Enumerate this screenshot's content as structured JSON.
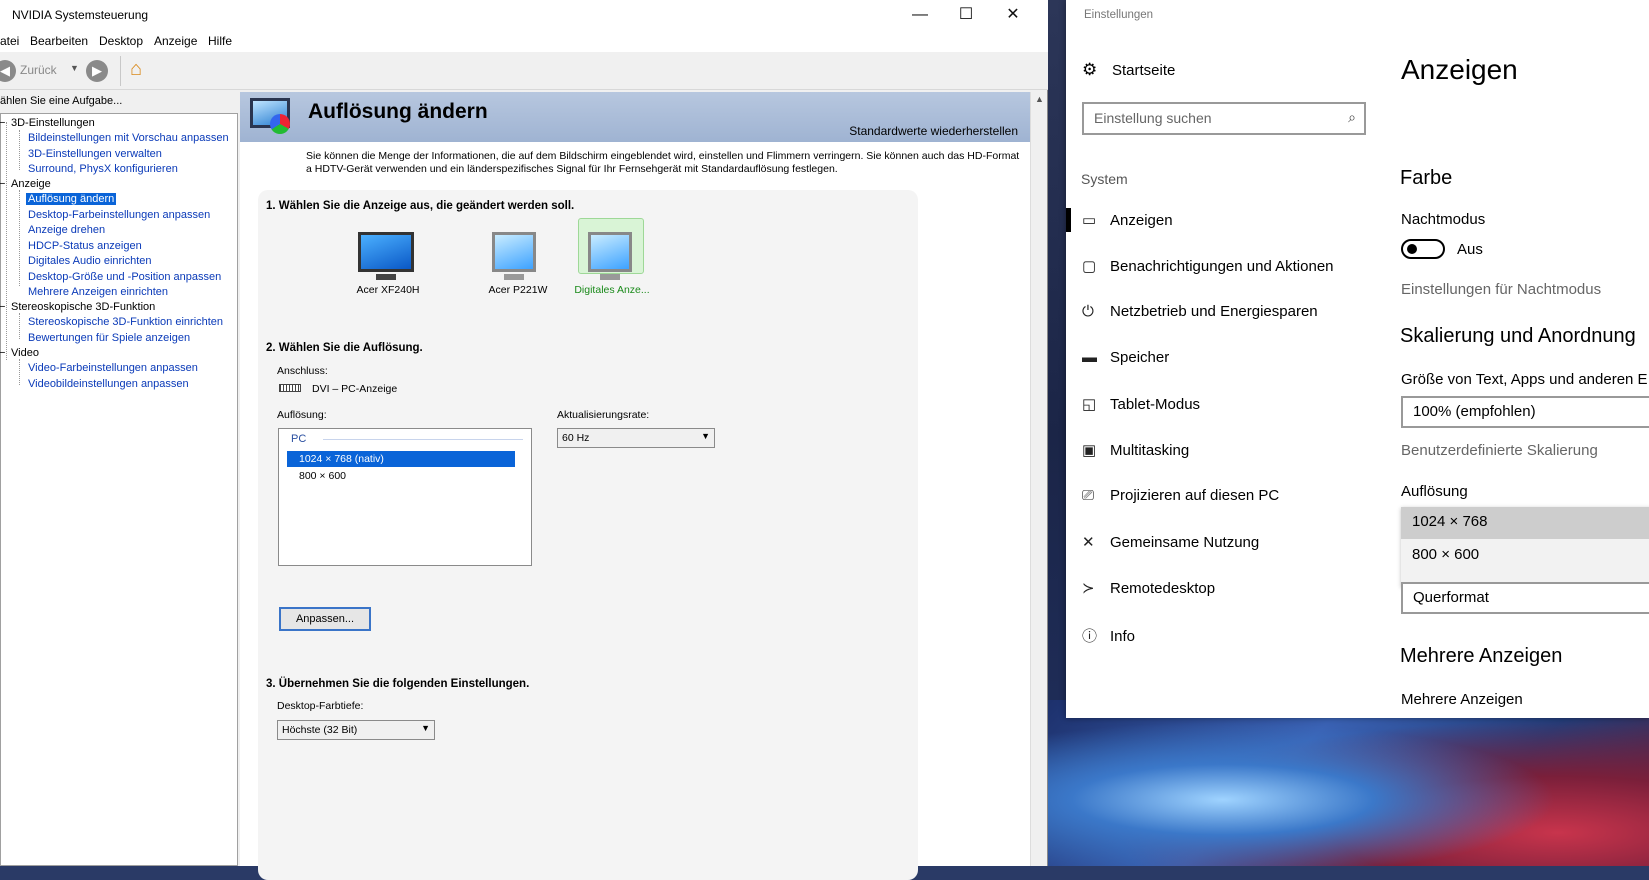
{
  "nv": {
    "title": "NVIDIA Systemsteuerung",
    "caption": {
      "min": "—",
      "max": "☐",
      "close": "✕"
    },
    "menu": [
      "atei",
      "Bearbeiten",
      "Desktop",
      "Anzeige",
      "Hilfe"
    ],
    "back_label": "Zurück",
    "task_label": "ählen Sie eine Aufgabe...",
    "tree": {
      "g3d": "3D-Einstellungen",
      "g3d_items": [
        "Bildeinstellungen mit Vorschau anpassen",
        "3D-Einstellungen verwalten",
        "Surround, PhysX konfigurieren"
      ],
      "gdisp": "Anzeige",
      "gdisp_items": [
        "Auflösung ändern",
        "Desktop-Farbeinstellungen anpassen",
        "Anzeige drehen",
        "HDCP-Status anzeigen",
        "Digitales Audio einrichten",
        "Desktop-Größe und -Position anpassen",
        "Mehrere Anzeigen einrichten"
      ],
      "gstereo": "Stereoskopische 3D-Funktion",
      "gstereo_items": [
        "Stereoskopische 3D-Funktion einrichten",
        "Bewertungen für Spiele anzeigen"
      ],
      "gvideo": "Video",
      "gvideo_items": [
        "Video-Farbeinstellungen anpassen",
        "Videobildeinstellungen anpassen"
      ]
    },
    "page_title": "Auflösung ändern",
    "restore": "Standardwerte wiederherstellen",
    "description": "Sie können die Menge der Informationen, die auf dem Bildschirm eingeblendet wird, einstellen und Flimmern verringern. Sie können auch das HD-Format a HDTV-Gerät verwenden und ein länderspezifisches Signal für Ihr Fernsehgerät mit Standardauflösung festlegen.",
    "step1": "1. Wählen Sie die Anzeige aus, die geändert werden soll.",
    "displays": [
      "Acer XF240H",
      "Acer P221W",
      "Digitales Anze..."
    ],
    "step2": "2. Wählen Sie die Auflösung.",
    "connection_label": "Anschluss:",
    "connection_value": "DVI – PC-Anzeige",
    "resolution_label": "Auflösung:",
    "resolution_group": "PC",
    "resolutions": [
      "1024 × 768 (nativ)",
      "800 × 600"
    ],
    "refresh_label": "Aktualisierungsrate:",
    "refresh_value": "60 Hz",
    "customize_button": "Anpassen...",
    "step3": "3. Übernehmen Sie die folgenden Einstellungen.",
    "depth_label": "Desktop-Farbtiefe:",
    "depth_value": "Höchste (32 Bit)"
  },
  "settings": {
    "window_title": "Einstellungen",
    "home": "Startseite",
    "search_placeholder": "Einstellung suchen",
    "section": "System",
    "nav": [
      "Anzeigen",
      "Benachrichtigungen und Aktionen",
      "Netzbetrieb und Energiesparen",
      "Speicher",
      "Tablet-Modus",
      "Multitasking",
      "Projizieren auf diesen PC",
      "Gemeinsame Nutzung",
      "Remotedesktop",
      "Info"
    ],
    "page_title": "Anzeigen",
    "color_heading": "Farbe",
    "night_mode_label": "Nachtmodus",
    "night_mode_state": "Aus",
    "night_mode_link": "Einstellungen für Nachtmodus",
    "scale_heading": "Skalierung und Anordnung",
    "scale_label": "Größe von Text, Apps und anderen E",
    "scale_value": "100% (empfohlen)",
    "custom_scale_link": "Benutzerdefinierte Skalierung",
    "resolution_label": "Auflösung",
    "resolution_options": [
      "1024 × 768",
      "800 × 600"
    ],
    "orientation_value": "Querformat",
    "multi_heading": "Mehrere Anzeigen",
    "multi_label": "Mehrere Anzeigen"
  }
}
